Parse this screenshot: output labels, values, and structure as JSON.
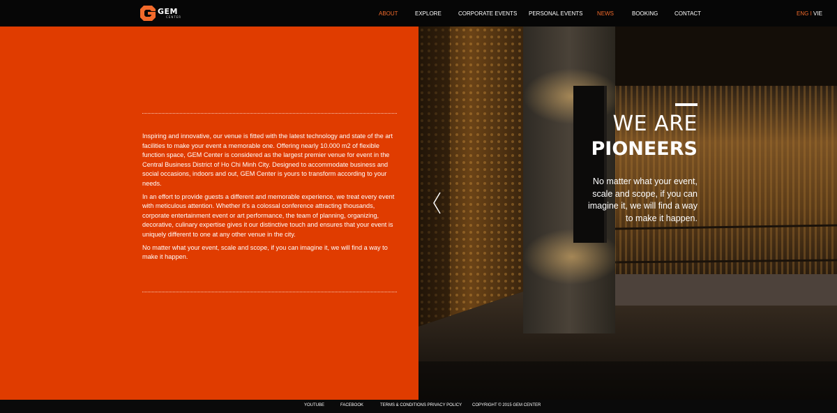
{
  "header": {
    "logo": {
      "word": "GEM",
      "subtext": "CENTER"
    },
    "nav": [
      {
        "label": "ABOUT",
        "active": true
      },
      {
        "label": "EXPLORE",
        "active": false
      },
      {
        "label": "CORPORATE EVENTS",
        "active": false
      },
      {
        "label": "PERSONAL EVENTS",
        "active": false
      },
      {
        "label": "NEWS",
        "active": true
      },
      {
        "label": "BOOKING",
        "active": false
      },
      {
        "label": "CONTACT",
        "active": false
      }
    ],
    "language": {
      "eng": "ENG",
      "separator": " I ",
      "vie": "VIE"
    }
  },
  "about": {
    "paragraphs": [
      "Inspiring and innovative, our venue is fitted with the latest technology and state of the art facilities to make your event a memorable one. Offering nearly 10.000 m2 of flexible function space, GEM Center is considered as the largest premier venue for event in the Central Business District of Ho Chi Minh City. Designed to accommodate business and social occasions, indoors and out, GEM Center is yours to transform according to your needs.",
      "In an effort to provide guests a different and memorable experience, we treat every event with meticulous attention. Whether it’s a colossal conference attracting thousands, corporate entertainment event or art performance, the team of planning, organizing, decorative, culinary expertise gives it our distinctive touch and ensures that your event is uniquely different to one at any other venue in the city.",
      "No matter what your event, scale and scope, if you can imagine it, we will find a way to make it happen."
    ]
  },
  "hero": {
    "line1": "WE ARE",
    "line2": "PIONEERS",
    "subtitle": "No matter what your event, scale and scope, if you can imagine it, we will find a way to make it happen.",
    "prev_icon": "chevron-left-icon"
  },
  "footer": {
    "links": [
      {
        "label": "YOUTUBE"
      },
      {
        "label": "FACEBOOK"
      },
      {
        "label": "TERMS & CONDITIONS PRIVACY POLICY"
      },
      {
        "label": "COPYRIGHT © 2015 GEM CENTER"
      }
    ]
  },
  "colors": {
    "accent": "#f26a2b",
    "panel": "#e03c00",
    "header_bg": "#060606"
  }
}
